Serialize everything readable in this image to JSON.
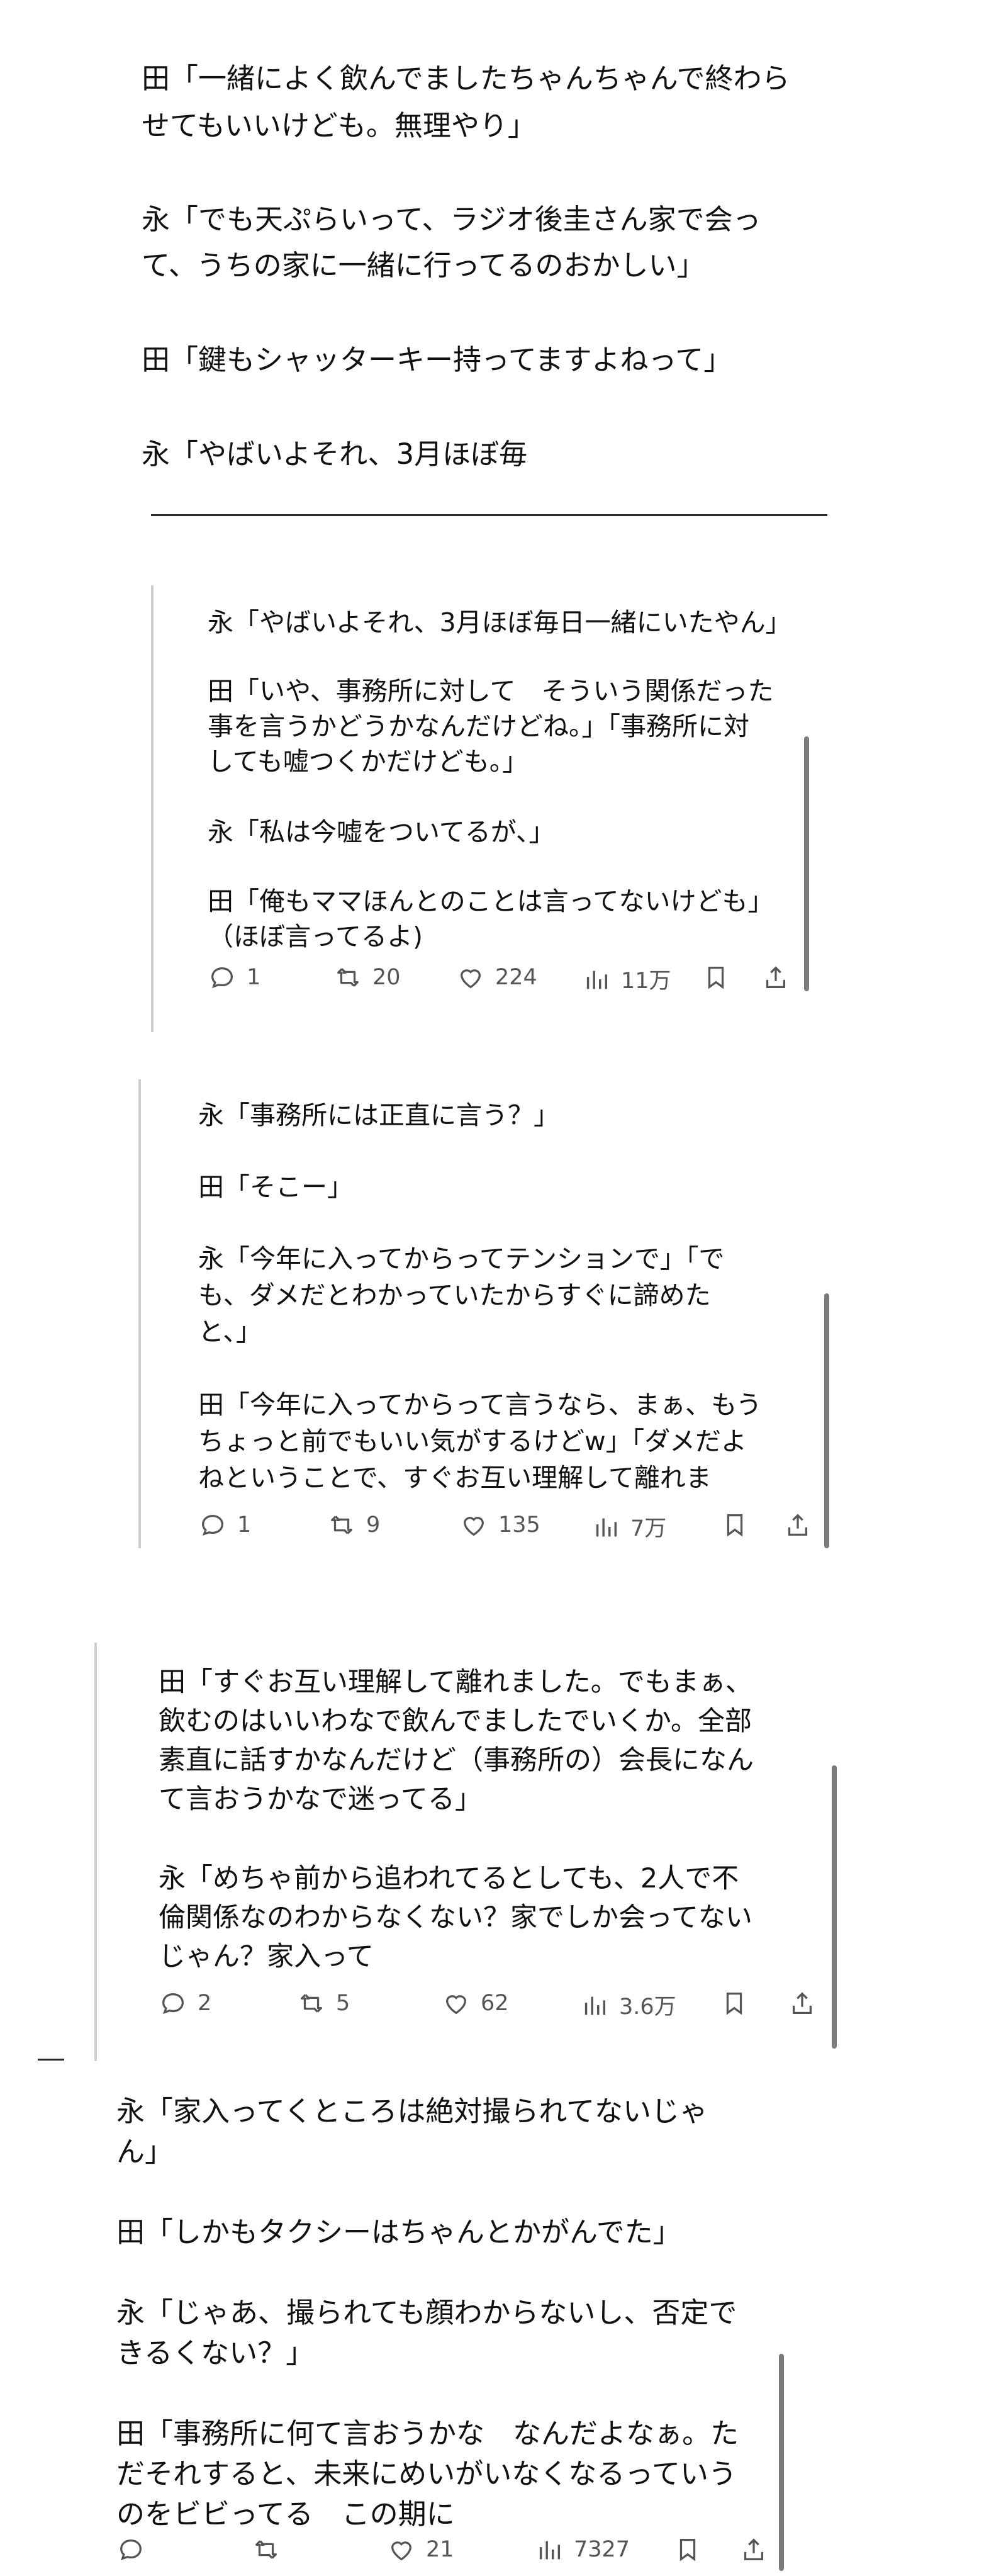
{
  "intro": {
    "lines": [
      "田「一緒によく飲んでましたちゃんちゃんで終わら",
      "せてもいいけども。無理やり」",
      "永「でも天ぷらいって、ラジオ後圭さん家で会っ",
      "て、うちの家に一緒に行ってるのおかしい」",
      "田「鍵もシャッターキー持ってますよねって」",
      "永「やばいよそれ、3月ほぼ毎"
    ]
  },
  "posts": [
    {
      "lines": [
        "永「やばいよそれ、3月ほぼ毎日一緒にいたやん」",
        "田「いや、事務所に対して　そういう関係だった",
        "事を言うかどうかなんだけどね。」「事務所に対",
        "しても嘘つくかだけども。」",
        "永「私は今嘘をついてるが、」",
        "田「俺もママほんとのことは言ってないけども」",
        "（ほぼ言ってるよ)"
      ],
      "stats": {
        "replies": "1",
        "reposts": "20",
        "likes": "224",
        "views": "11万"
      }
    },
    {
      "lines": [
        "永「事務所には正直に言う？」",
        "田「そこー」",
        "永「今年に入ってからってテンションで」「で",
        "も、ダメだとわかっていたからすぐに諦めた",
        "と、」",
        "田「今年に入ってからって言うなら、まぁ、もう",
        "ちょっと前でもいい気がするけどw」「ダメだよ",
        "ねということで、すぐお互い理解して離れま"
      ],
      "stats": {
        "replies": "1",
        "reposts": "9",
        "likes": "135",
        "views": "7万"
      }
    },
    {
      "lines": [
        "田「すぐお互い理解して離れました。でもまぁ、",
        "飲むのはいいわなで飲んでましたでいくか。全部",
        "素直に話すかなんだけど（事務所の）会長になん",
        "て言おうかなで迷ってる」",
        "永「めちゃ前から追われてるとしても、2人で不",
        "倫関係なのわからなくない？家でしか会ってない",
        "じゃん？家入って"
      ],
      "stats": {
        "replies": "2",
        "reposts": "5",
        "likes": "62",
        "views": "3.6万"
      }
    },
    {
      "lines": [
        "永「家入ってくところは絶対撮られてないじゃ",
        "ん」",
        "田「しかもタクシーはちゃんとかがんでた」",
        "永「じゃあ、撮られても顔わからないし、否定で",
        "きるくない？」",
        "田「事務所に何て言おうかな　なんだよなぁ。た",
        "だそれすると、未来にめいがいなくなるっていう",
        "のをビビってる　この期に"
      ],
      "stats": {
        "replies": "",
        "reposts": "",
        "likes": "21",
        "views": "7327"
      }
    }
  ]
}
